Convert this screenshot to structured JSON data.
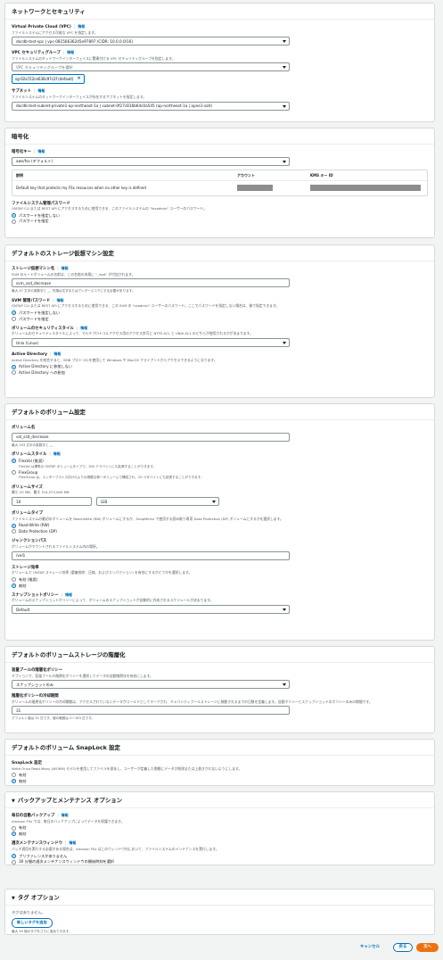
{
  "network": {
    "title": "ネットワークとセキュリティ",
    "info": "情報",
    "vpc_label": "Virtual Private Cloud (VPC)",
    "vpc_desc": "ファイルシステムにアクセス可能な VPC を指定します。",
    "vpc_value": "docdb-test-vpc | vpc-08156636245e97897 (CIDR: 10.0.0.0/16)",
    "sg_label": "VPC セキュリティグループ",
    "sg_desc": "ファイルシステムのネットワークインターフェイスに関連付ける VPC セキュリティグループを指定します。",
    "sg_placeholder": "VPC セキュリティグループを選択",
    "sg_token": "sg-02a722ce636c97c2f (default)",
    "subnet_label": "サブネット",
    "subnet_desc": "ファイルシステムのネットワークインターフェイスが存在するサブネットを指定します。",
    "subnet_value": "docdb-test-subnet-private1-ap-northeast-1a | subnet-0f27c816b64c0a545 (ap-northeast-1a | apne1-az4)"
  },
  "encryption": {
    "title": "暗号化",
    "key_label": "暗号化キー",
    "info": "情報",
    "key_value": "aws/fsx (デフォルト)",
    "col_desc": "説明",
    "col_account": "アカウント",
    "col_kms": "KMS キー ID",
    "row_desc": "Default key that protects my FSx resources when no other key is defined",
    "admin_pw_label": "ファイルシステム管理パスワード",
    "admin_pw_desc": "ONTAP CLI または REST API にアクセスするために使用できる、このファイルシステムの \"fsxadmin\" ユーザーのパスワード。",
    "pw_opt1": "パスワードを指定しない",
    "pw_opt2": "パスワードを指定"
  },
  "svm": {
    "title": "デフォルトのストレージ仮想マシン設定",
    "name_label": "ストレージ仮想マシン名",
    "info": "情報",
    "name_desc": "SVM のルートボリュームの名前は、この名前の末尾に \"_root\" が付加されます。",
    "name_value": "svm_ssd_decrease",
    "name_hint": "最大 47 文字の英数字と _、先頭は文字またはアンダースコアにする必要があります。",
    "pw_label": "SVM 管理パスワード",
    "pw_desc": "ONTAP CLI または REST API にアクセスするために使用できる、この SVM の \"vsadmin\" ユーザーのパスワード。ここでパスワードを指定しない場合は、後で指定できます。",
    "pw_opt1": "パスワードを指定しない",
    "pw_opt2": "パスワードを指定",
    "style_label": "ボリュームのセキュリティスタイル",
    "style_desc": "ボリュームのセキュリティスタイルによって、マルチプロトコルアクセス用のアクセス許可に NTFS ACL と UNIX ACL のどちらが使用されるかが決まります。",
    "style_value": "Unix (Linux)",
    "ad_label": "Active Directory",
    "ad_desc": "Active Directory を結合すると、SMB プロトコルを使用して Windows や MacOS クライアントからアクセスできるようになります。",
    "ad_opt1": "Active Directory に参加しない",
    "ad_opt2": "Active Directory への参加"
  },
  "volume": {
    "title": "デフォルトのボリューム設定",
    "name_label": "ボリューム名",
    "name_value": "vol_ssd_decrease",
    "name_hint": "最大 203 文字の英数字と _。",
    "style_label": "ボリュームスタイル",
    "info": "情報",
    "flexvol": "FlexVol (推奨)",
    "flexvol_desc": "FlexVol は標準の ONTAP ボリュームタイプで、300 テラバイトにも拡張することができます。",
    "flexgroup": "FlexGroup",
    "flexgroup_desc": "FlexGroup は、エンタープライズ向けのより大規模な単一ボリュームで構成され、20 ペタバイトにも拡張することができます。",
    "size_label": "ボリュームサイズ",
    "size_desc": "最小 20 MB、最大 314,572,800 MB",
    "size_value": "10",
    "size_unit": "GiB",
    "type_label": "ボリュームタイプ",
    "type_desc": "ファイルシステムの最初のボリュームを Read-Write (RW) ボリュームにするか、SnapMirror で使用する読み取り専用 Data Protection (DP) ボリュームにするかを選択します。",
    "type_rw": "Read-Write (RW)",
    "type_dp": "Data Protection (DP)",
    "junction_label": "ジャンクションパス",
    "junction_desc": "ボリュームがマウントされるファイルシステム内の場所。",
    "junction_value": "/vol1",
    "eff_label": "ストレージ効率",
    "eff_desc": "ボリュームで ONTAP ストレージ効率 (重複排除、圧縮、およびコンパクション) を有効にするかどうかを選択します。",
    "eff_on": "有効 (推奨)",
    "eff_off": "無効",
    "snap_label": "スナップショットポリシー",
    "snap_desc": "ボリュームのスナップショットポリシーによって、ボリュームのスナップショットが自動的に作成されるスケジュールが決まります。",
    "snap_value": "Default"
  },
  "tiering": {
    "title": "デフォルトのボリュームストレージの階層化",
    "policy_label": "容量プールの階層化ポリシー",
    "policy_desc": "オプションで、容量プールの階層化ポリシーを選択してデータの自動階層化を有効にします。",
    "policy_value": "スナップショットのみ",
    "cooling_label": "階層化ポリシーの冷却期間",
    "cooling_desc": "ボリュームの階層化ポリシーの冷却期間は、アクセスされていないデータがコールドとしてマークされ、キャパシティプールストレージに移動されるまでの日数を定義します。自動ポリシーとスナップショットのポリシーのみの期間です。",
    "cooling_value": "31",
    "cooling_hint": "デフォルト値は 31 日です。値の範囲は 2〜183 日です。"
  },
  "snaplock": {
    "title": "デフォルトのボリューム SnapLock 設定",
    "label": "SnapLock 設定",
    "desc": "Write Once Read Many (WORM) モデルを使用してファイルを保存し、ユーザーが定義した期間にデータが削除または上書きされないようにします。",
    "opt_on": "有効",
    "opt_off": "無効"
  },
  "backup": {
    "title": "バックアップとメンテナンス オプション",
    "auto_label": "毎日の自動バックアップ",
    "info": "情報",
    "auto_desc": "Amazon FSx では、毎日のバックアップによってデータを保護できます。",
    "auto_on": "有効",
    "auto_off": "無効",
    "maint_label": "週次メンテナンスウィンドウ",
    "maint_desc": "パッチ適用を実行する必要がある場合は、Amazon FSx はこのウィンドウ内において、ファイルシステムのメンテナンスを実行します。",
    "maint_opt1": "プリファレンスがありません",
    "maint_opt2": "30 分間の週次メンテナンスウィンドウの開始時刻を選択"
  },
  "tags": {
    "title": "タグ オプション",
    "empty": "タグはありません。",
    "add_button": "新しいタグを追加",
    "hint": "最大 49 個のタグをさらに追加できます。"
  },
  "footer": {
    "cancel": "キャンセル",
    "back": "戻る",
    "next": "次へ"
  }
}
